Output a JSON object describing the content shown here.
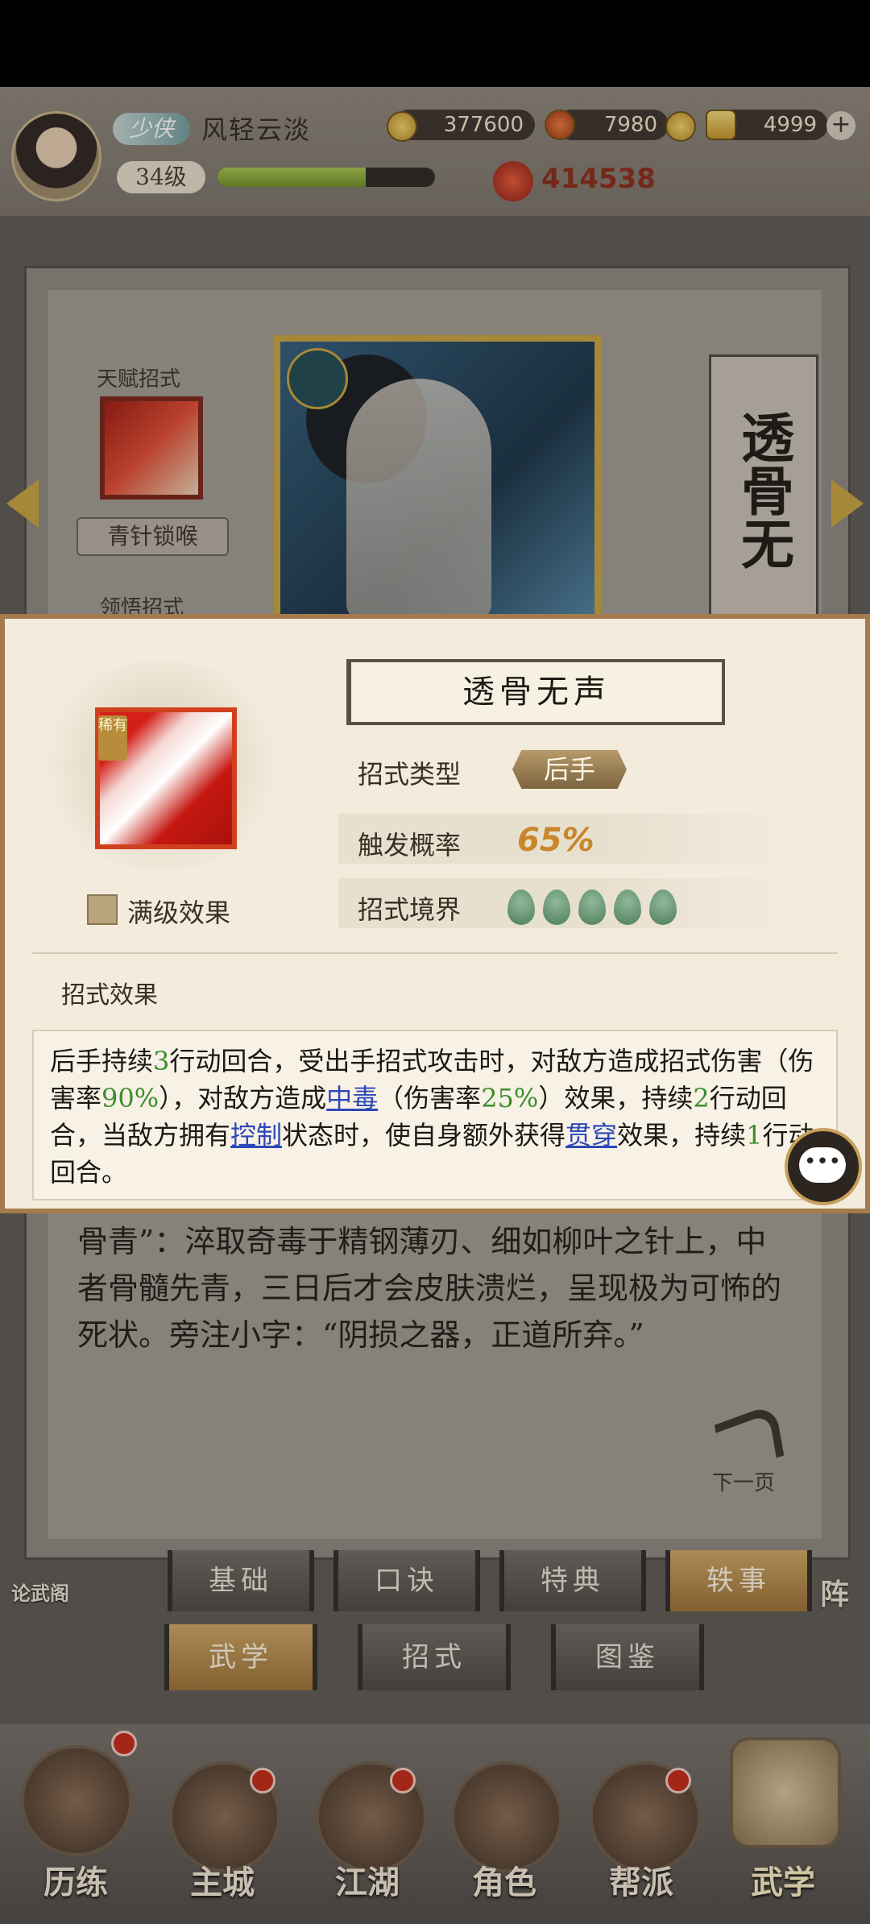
{
  "player": {
    "rank": "少侠",
    "name": "风轻云淡",
    "level": "34级",
    "exp_fraction": 0.68,
    "power": "414538"
  },
  "resources": {
    "coins": "377600",
    "energy": "7980",
    "ingots": "4999"
  },
  "background_page": {
    "talent_label": "天赋招式",
    "talent_skill": "青针锁喉",
    "comprehend_label": "领悟招式",
    "vertical_title": "透骨无",
    "lore": "骨青”：淬取奇毒于精钢薄刃、细如柳叶之针上，中者骨髓先青，三日后才会皮肤溃烂，呈现极为可怖的死状。旁注小字：“阴损之器，正道所弃。”",
    "next_page": "下一页"
  },
  "modal": {
    "title": "透骨无声",
    "rarity": "稀有",
    "max_level_label": "满级效果",
    "type_label": "招式类型",
    "type_value": "后手",
    "trigger_label": "触发概率",
    "trigger_value": "65%",
    "realm_label": "招式境界",
    "realm_tiers": 5,
    "effect_title": "招式效果",
    "effect_segments": [
      {
        "t": "后手持续",
        "c": ""
      },
      {
        "t": "3",
        "c": "num"
      },
      {
        "t": "行动回合，受出手招式攻击时，对敌方造成招式伤害（伤害率",
        "c": ""
      },
      {
        "t": "90%",
        "c": "num"
      },
      {
        "t": "），对敌方造成",
        "c": ""
      },
      {
        "t": "中毒",
        "c": "kw"
      },
      {
        "t": "（伤害率",
        "c": ""
      },
      {
        "t": "25%",
        "c": "num"
      },
      {
        "t": "）效果，持续",
        "c": ""
      },
      {
        "t": "2",
        "c": "num"
      },
      {
        "t": "行动回合，当敌方拥有",
        "c": ""
      },
      {
        "t": "控制",
        "c": "kw"
      },
      {
        "t": "状态时，使自身额外获得",
        "c": ""
      },
      {
        "t": "贯穿",
        "c": "kw"
      },
      {
        "t": "效果，持续",
        "c": ""
      },
      {
        "t": "1",
        "c": "num"
      },
      {
        "t": "行动回合。",
        "c": ""
      }
    ],
    "chat_glyph": "•••"
  },
  "sub_tabs": [
    "基础",
    "口诀",
    "特典",
    "轶事"
  ],
  "side_labels": {
    "left": "论武阁",
    "right": "阵"
  },
  "main_tabs": [
    "武学",
    "招式",
    "图鉴"
  ],
  "bottom_nav": [
    "历练",
    "主城",
    "江湖",
    "角色",
    "帮派",
    "武学"
  ],
  "colors": {
    "accent": "#c9a440",
    "number": "#3b8e2c",
    "keyword": "#2c48b8",
    "trigger": "#c8872a"
  }
}
